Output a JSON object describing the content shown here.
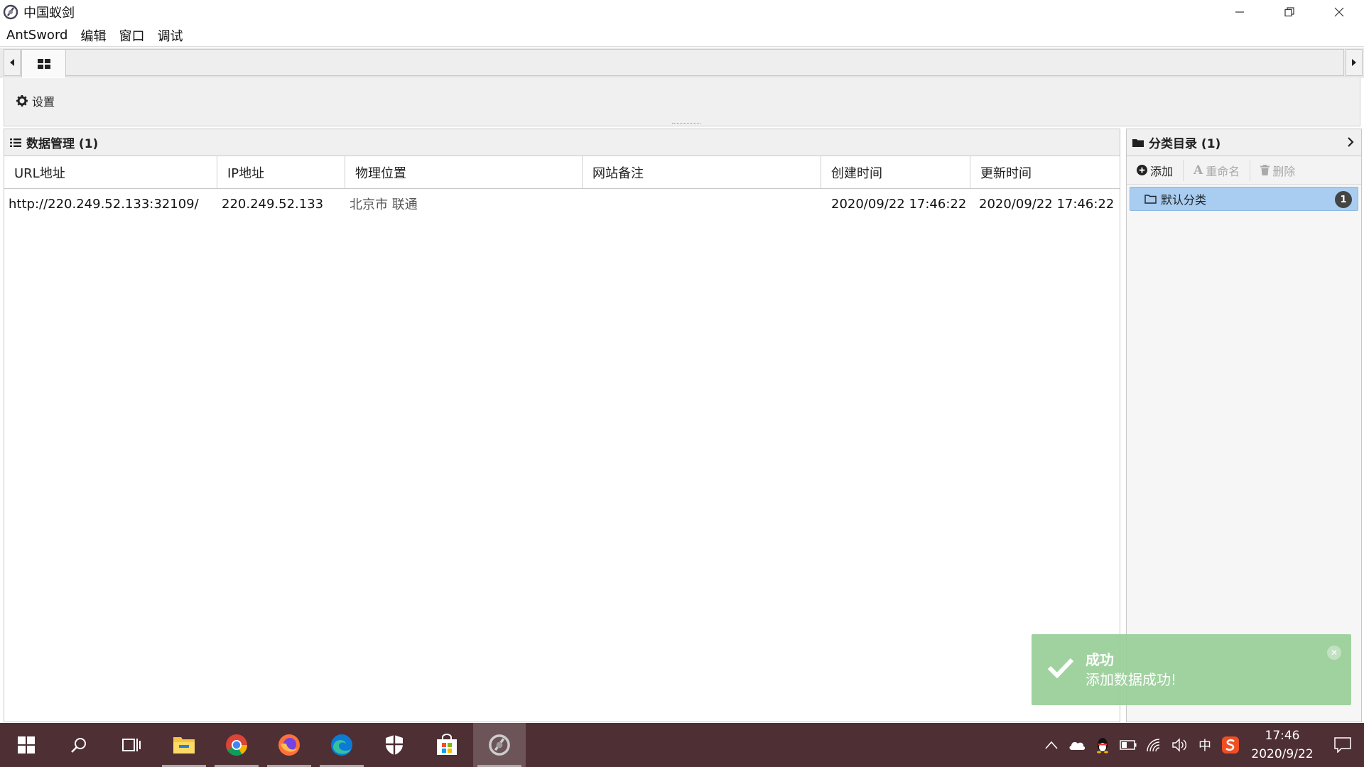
{
  "window": {
    "title": "中国蚁剑"
  },
  "menu": {
    "items": [
      "AntSword",
      "编辑",
      "窗口",
      "调试"
    ]
  },
  "toolbar": {
    "settings_label": "设置"
  },
  "data_panel": {
    "title": "数据管理 (1)",
    "columns": [
      "URL地址",
      "IP地址",
      "物理位置",
      "网站备注",
      "创建时间",
      "更新时间"
    ],
    "rows": [
      {
        "url": "http://220.249.52.133:32109/",
        "ip": "220.249.52.133",
        "location": "北京市 联通",
        "note": "",
        "created": "2020/09/22 17:46:22",
        "updated": "2020/09/22 17:46:22"
      }
    ]
  },
  "category_panel": {
    "title": "分类目录 (1)",
    "add_label": "添加",
    "rename_label": "重命名",
    "delete_label": "删除",
    "items": [
      {
        "name": "默认分类",
        "count": "1"
      }
    ]
  },
  "toast": {
    "title": "成功",
    "message": "添加数据成功!"
  },
  "taskbar": {
    "time": "17:46",
    "date": "2020/9/22",
    "ime": "中"
  },
  "colors": {
    "selection": "#a8cdf0",
    "toast": "#98ce98",
    "taskbar": "#4e2f34"
  }
}
